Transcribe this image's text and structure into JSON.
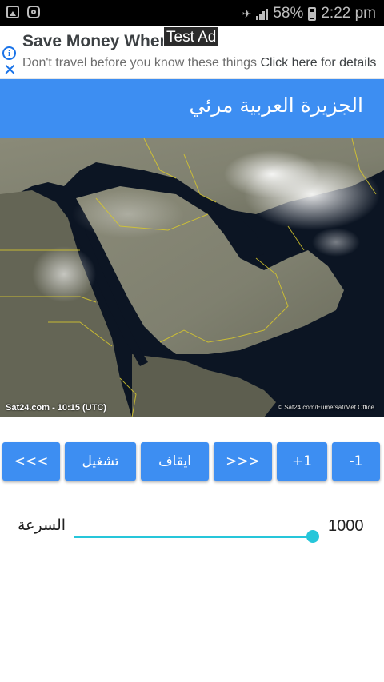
{
  "status_bar": {
    "battery": "58%",
    "time": "2:22 pm"
  },
  "ad": {
    "headline": "Save Money When",
    "badge": "Test Ad",
    "body": "Don't travel before you know these things",
    "cta": "Click here for details"
  },
  "title_bar": {
    "title": "الجزيرة العربية مرئي"
  },
  "satellite": {
    "credit_left": "Sat24.com - 10:15 (UTC)",
    "credit_right": "© Sat24.com/Eumetsat/Met Office"
  },
  "controls": {
    "first": "<<<",
    "play": "تشغيل",
    "stop": "ايقاف",
    "last": ">>>",
    "plus_one": "+1",
    "minus_one": "-1"
  },
  "speed": {
    "label": "السرعة",
    "value": "1000",
    "level": 1.0
  },
  "colors": {
    "primary": "#3d8ef2",
    "slider": "#26c6da",
    "status_bar": "#000000"
  }
}
